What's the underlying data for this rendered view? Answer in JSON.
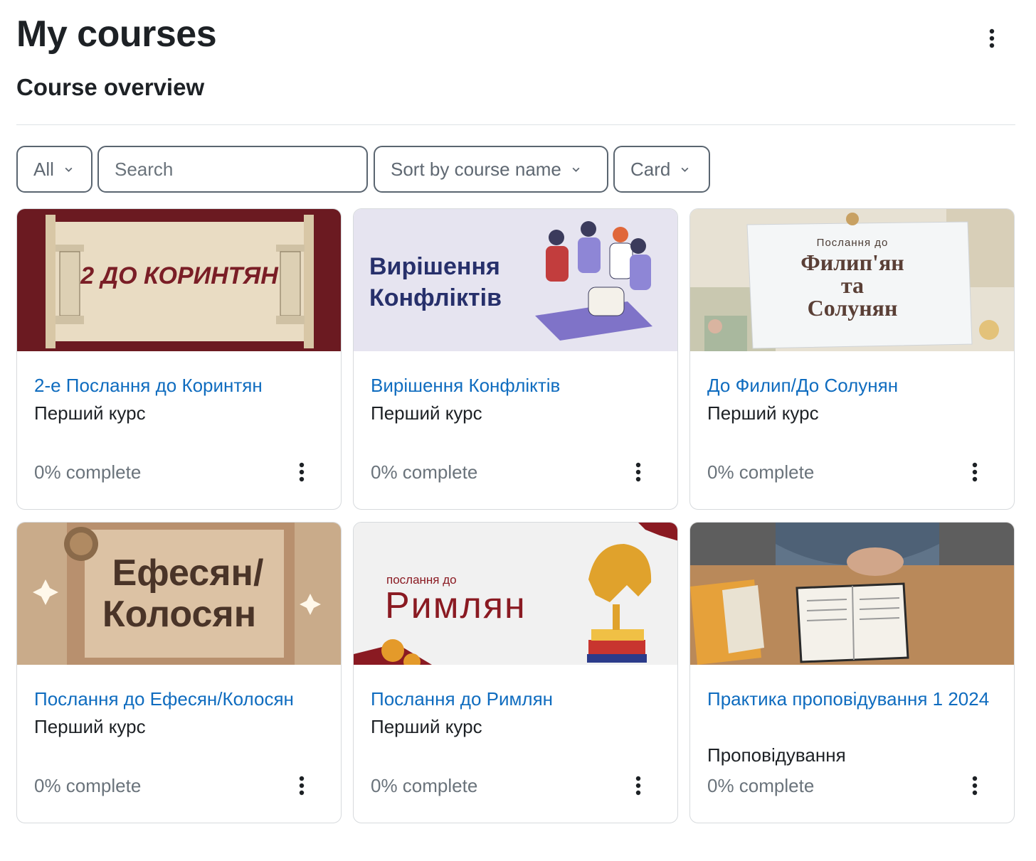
{
  "page": {
    "title": "My courses"
  },
  "overview": {
    "title": "Course overview",
    "filter_value": "All",
    "search_placeholder": "Search",
    "sort_value": "Sort by course name",
    "view_value": "Card"
  },
  "thumb_text": {
    "c1": "2 ДО КОРИНТЯН",
    "c2_line1": "Вирішення",
    "c2_line2": "Конфліктів",
    "c3_small": "Послання до",
    "c3_line1": "Филип'ян",
    "c3_line2": "та",
    "c3_line3": "Солунян",
    "c4_line1": "Ефесян/",
    "c4_line2": "Колосян",
    "c5_small": "послання до",
    "c5_big": "Римлян"
  },
  "courses": [
    {
      "name": "2-е Послання до Коринтян",
      "category": "Перший курс",
      "progress": "0% complete"
    },
    {
      "name": "Вирішення Конфліктів",
      "category": "Перший курс",
      "progress": "0% complete"
    },
    {
      "name": "До Филип/До Солунян",
      "category": "Перший курс",
      "progress": "0% complete"
    },
    {
      "name": "Послання до Ефесян/Колосян",
      "category": "Перший курс",
      "progress": "0% complete"
    },
    {
      "name": "Послання до Римлян",
      "category": "Перший курс",
      "progress": "0% complete"
    },
    {
      "name": "Практика проповідування 1 2024",
      "category": "Проповідування",
      "progress": "0% complete"
    }
  ],
  "colors": {
    "link": "#0f6cbf",
    "text": "#1d2125",
    "muted": "#6a737b",
    "border": "#d7dadd"
  },
  "icons": [
    "kebab-menu-icon",
    "chevron-down-icon"
  ]
}
